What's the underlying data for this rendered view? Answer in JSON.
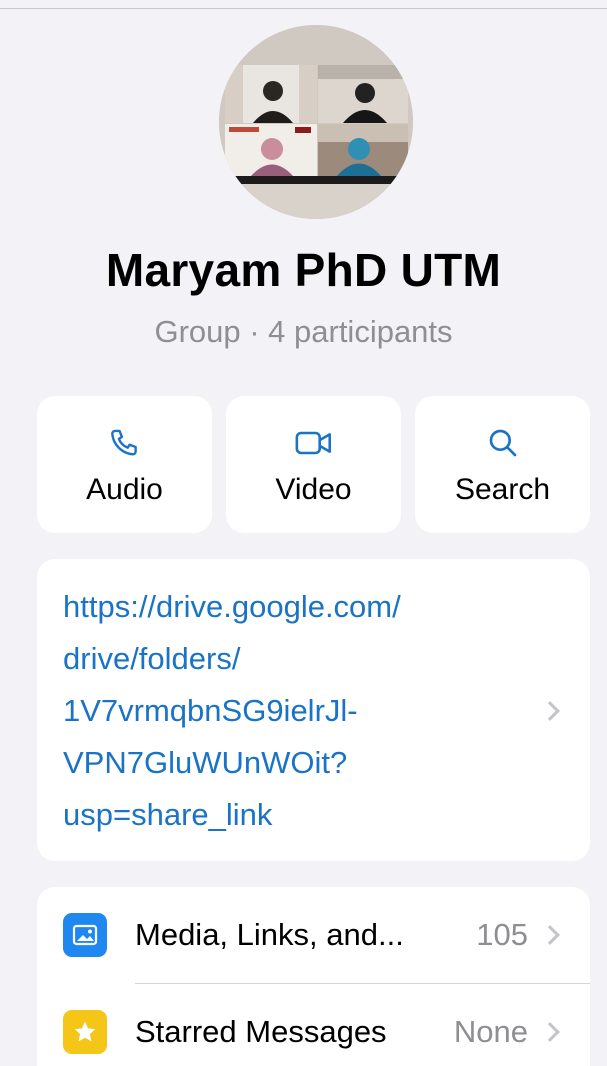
{
  "group": {
    "name": "Maryam PhD UTM",
    "subtitle": "Group · 4 participants"
  },
  "actions": [
    {
      "label": "Audio",
      "icon": "phone-icon"
    },
    {
      "label": "Video",
      "icon": "video-camera-icon"
    },
    {
      "label": "Search",
      "icon": "search-icon"
    }
  ],
  "description": {
    "link": "https://drive.google.com/drive/folders/1V7vrmqbnSG9ielrJl-VPN7GluWUnWOit?usp=share_link",
    "link_lines": [
      "https://drive.google.com/",
      "drive/folders/",
      "1V7vrmqbnSG9ielrJl-",
      "VPN7GluWUnWOit?",
      "usp=share_link"
    ]
  },
  "list": [
    {
      "label": "Media, Links, and...",
      "value": "105",
      "icon": "photo-icon",
      "color": "#1e88f0"
    },
    {
      "label": "Starred Messages",
      "value": "None",
      "icon": "star-icon",
      "color": "#f5c518"
    }
  ],
  "colors": {
    "accent": "#1a73c7",
    "background": "#f2f2f7",
    "secondary_text": "#8e8e93"
  }
}
